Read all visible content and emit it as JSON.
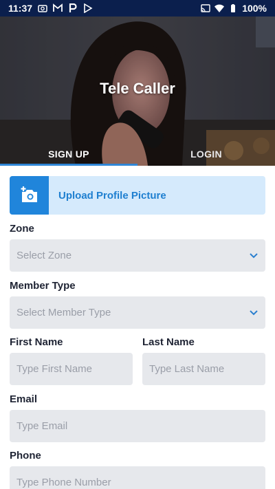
{
  "status_bar": {
    "time": "11:37",
    "battery": "100%",
    "left_icons": [
      "camera-icon",
      "gmail-icon",
      "parking-icon",
      "play-store-icon"
    ],
    "right_icons": [
      "cast-icon",
      "wifi-icon",
      "battery-icon"
    ]
  },
  "header": {
    "title": "Tele Caller",
    "tabs": [
      {
        "label": "SIGN UP",
        "active": true
      },
      {
        "label": "LOGIN",
        "active": false
      }
    ],
    "accent": "#2f86d6"
  },
  "upload": {
    "label": "Upload Profile Picture",
    "icon": "add-photo-icon"
  },
  "form": {
    "zone": {
      "label": "Zone",
      "placeholder": "Select Zone"
    },
    "member_type": {
      "label": "Member Type",
      "placeholder": "Select Member Type"
    },
    "first_name": {
      "label": "First Name",
      "placeholder": "Type First Name"
    },
    "last_name": {
      "label": "Last Name",
      "placeholder": "Type Last Name"
    },
    "email": {
      "label": "Email",
      "placeholder": "Type Email"
    },
    "phone": {
      "label": "Phone",
      "placeholder": "Type Phone Number"
    }
  },
  "colors": {
    "status_bar_bg": "#0b1f4d",
    "upload_bg": "#d5eafc",
    "upload_icon_bg": "#2085db",
    "field_bg": "#e6e8ec"
  }
}
